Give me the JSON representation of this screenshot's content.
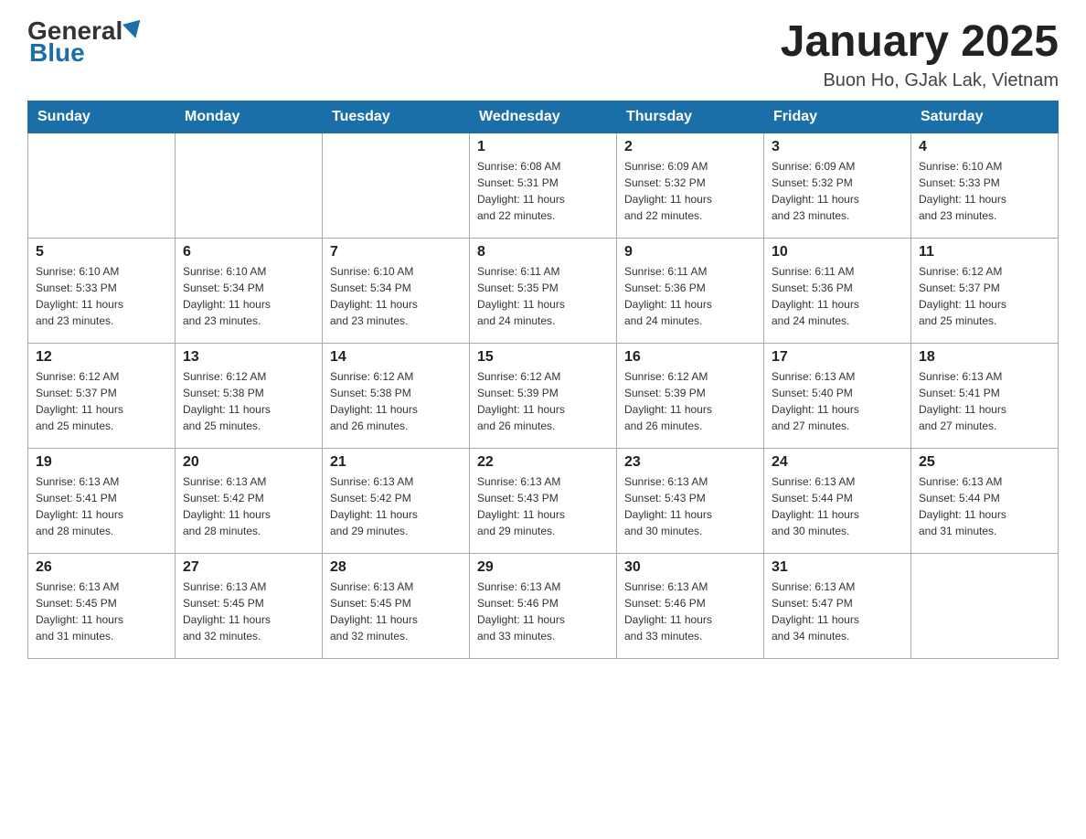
{
  "header": {
    "logo_general": "General",
    "logo_blue": "Blue",
    "title": "January 2025",
    "subtitle": "Buon Ho, GJak Lak, Vietnam"
  },
  "days_of_week": [
    "Sunday",
    "Monday",
    "Tuesday",
    "Wednesday",
    "Thursday",
    "Friday",
    "Saturday"
  ],
  "weeks": [
    [
      {
        "num": "",
        "info": ""
      },
      {
        "num": "",
        "info": ""
      },
      {
        "num": "",
        "info": ""
      },
      {
        "num": "1",
        "info": "Sunrise: 6:08 AM\nSunset: 5:31 PM\nDaylight: 11 hours\nand 22 minutes."
      },
      {
        "num": "2",
        "info": "Sunrise: 6:09 AM\nSunset: 5:32 PM\nDaylight: 11 hours\nand 22 minutes."
      },
      {
        "num": "3",
        "info": "Sunrise: 6:09 AM\nSunset: 5:32 PM\nDaylight: 11 hours\nand 23 minutes."
      },
      {
        "num": "4",
        "info": "Sunrise: 6:10 AM\nSunset: 5:33 PM\nDaylight: 11 hours\nand 23 minutes."
      }
    ],
    [
      {
        "num": "5",
        "info": "Sunrise: 6:10 AM\nSunset: 5:33 PM\nDaylight: 11 hours\nand 23 minutes."
      },
      {
        "num": "6",
        "info": "Sunrise: 6:10 AM\nSunset: 5:34 PM\nDaylight: 11 hours\nand 23 minutes."
      },
      {
        "num": "7",
        "info": "Sunrise: 6:10 AM\nSunset: 5:34 PM\nDaylight: 11 hours\nand 23 minutes."
      },
      {
        "num": "8",
        "info": "Sunrise: 6:11 AM\nSunset: 5:35 PM\nDaylight: 11 hours\nand 24 minutes."
      },
      {
        "num": "9",
        "info": "Sunrise: 6:11 AM\nSunset: 5:36 PM\nDaylight: 11 hours\nand 24 minutes."
      },
      {
        "num": "10",
        "info": "Sunrise: 6:11 AM\nSunset: 5:36 PM\nDaylight: 11 hours\nand 24 minutes."
      },
      {
        "num": "11",
        "info": "Sunrise: 6:12 AM\nSunset: 5:37 PM\nDaylight: 11 hours\nand 25 minutes."
      }
    ],
    [
      {
        "num": "12",
        "info": "Sunrise: 6:12 AM\nSunset: 5:37 PM\nDaylight: 11 hours\nand 25 minutes."
      },
      {
        "num": "13",
        "info": "Sunrise: 6:12 AM\nSunset: 5:38 PM\nDaylight: 11 hours\nand 25 minutes."
      },
      {
        "num": "14",
        "info": "Sunrise: 6:12 AM\nSunset: 5:38 PM\nDaylight: 11 hours\nand 26 minutes."
      },
      {
        "num": "15",
        "info": "Sunrise: 6:12 AM\nSunset: 5:39 PM\nDaylight: 11 hours\nand 26 minutes."
      },
      {
        "num": "16",
        "info": "Sunrise: 6:12 AM\nSunset: 5:39 PM\nDaylight: 11 hours\nand 26 minutes."
      },
      {
        "num": "17",
        "info": "Sunrise: 6:13 AM\nSunset: 5:40 PM\nDaylight: 11 hours\nand 27 minutes."
      },
      {
        "num": "18",
        "info": "Sunrise: 6:13 AM\nSunset: 5:41 PM\nDaylight: 11 hours\nand 27 minutes."
      }
    ],
    [
      {
        "num": "19",
        "info": "Sunrise: 6:13 AM\nSunset: 5:41 PM\nDaylight: 11 hours\nand 28 minutes."
      },
      {
        "num": "20",
        "info": "Sunrise: 6:13 AM\nSunset: 5:42 PM\nDaylight: 11 hours\nand 28 minutes."
      },
      {
        "num": "21",
        "info": "Sunrise: 6:13 AM\nSunset: 5:42 PM\nDaylight: 11 hours\nand 29 minutes."
      },
      {
        "num": "22",
        "info": "Sunrise: 6:13 AM\nSunset: 5:43 PM\nDaylight: 11 hours\nand 29 minutes."
      },
      {
        "num": "23",
        "info": "Sunrise: 6:13 AM\nSunset: 5:43 PM\nDaylight: 11 hours\nand 30 minutes."
      },
      {
        "num": "24",
        "info": "Sunrise: 6:13 AM\nSunset: 5:44 PM\nDaylight: 11 hours\nand 30 minutes."
      },
      {
        "num": "25",
        "info": "Sunrise: 6:13 AM\nSunset: 5:44 PM\nDaylight: 11 hours\nand 31 minutes."
      }
    ],
    [
      {
        "num": "26",
        "info": "Sunrise: 6:13 AM\nSunset: 5:45 PM\nDaylight: 11 hours\nand 31 minutes."
      },
      {
        "num": "27",
        "info": "Sunrise: 6:13 AM\nSunset: 5:45 PM\nDaylight: 11 hours\nand 32 minutes."
      },
      {
        "num": "28",
        "info": "Sunrise: 6:13 AM\nSunset: 5:45 PM\nDaylight: 11 hours\nand 32 minutes."
      },
      {
        "num": "29",
        "info": "Sunrise: 6:13 AM\nSunset: 5:46 PM\nDaylight: 11 hours\nand 33 minutes."
      },
      {
        "num": "30",
        "info": "Sunrise: 6:13 AM\nSunset: 5:46 PM\nDaylight: 11 hours\nand 33 minutes."
      },
      {
        "num": "31",
        "info": "Sunrise: 6:13 AM\nSunset: 5:47 PM\nDaylight: 11 hours\nand 34 minutes."
      },
      {
        "num": "",
        "info": ""
      }
    ]
  ]
}
